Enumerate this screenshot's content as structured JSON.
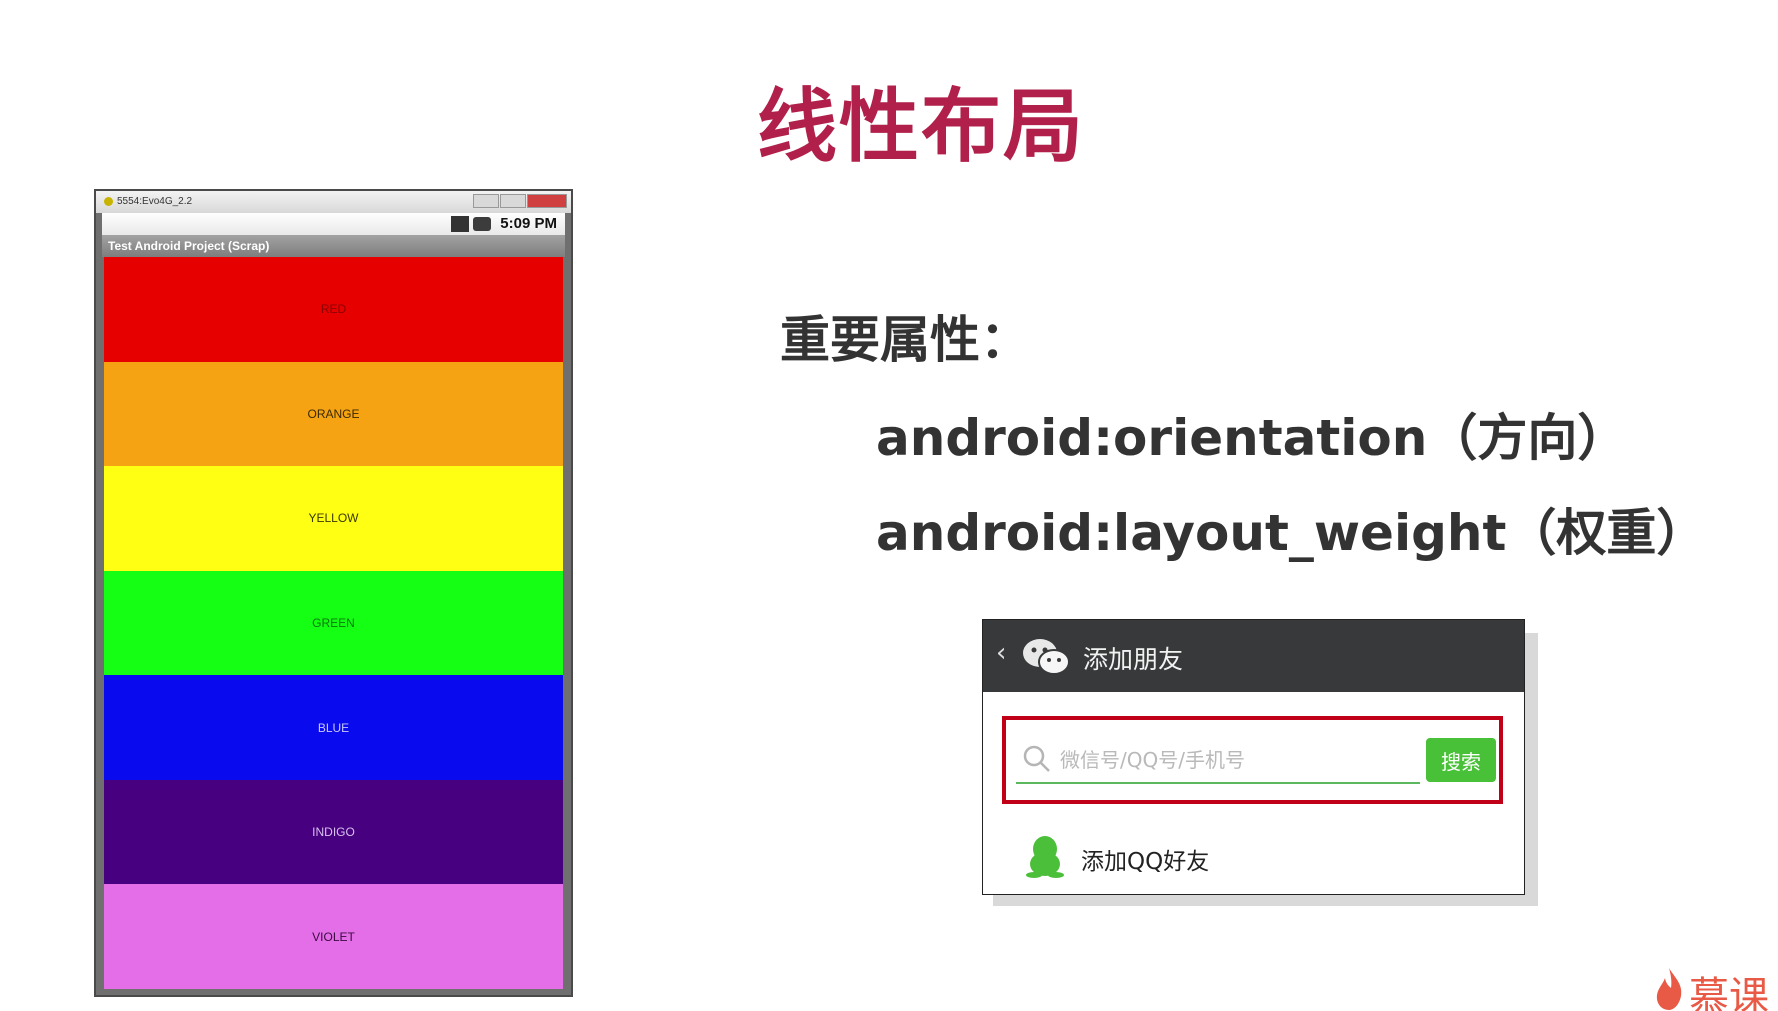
{
  "slide": {
    "title": "线性布局"
  },
  "emulator": {
    "window_title": "5554:Evo4G_2.2",
    "clock": "5:09 PM",
    "app_title": "Test Android Project (Scrap)",
    "stripes": [
      {
        "label": "RED",
        "bg": "#e60000",
        "fg": "#8a0000"
      },
      {
        "label": "ORANGE",
        "bg": "#f6a313",
        "fg": "#3a2a00"
      },
      {
        "label": "YELLOW",
        "bg": "#ffff14",
        "fg": "#3a3a00"
      },
      {
        "label": "GREEN",
        "bg": "#14ff14",
        "fg": "#0a7a0a"
      },
      {
        "label": "BLUE",
        "bg": "#0a0aee",
        "fg": "#c8c8ff"
      },
      {
        "label": "INDIGO",
        "bg": "#47007f",
        "fg": "#d8c0f0"
      },
      {
        "label": "VIOLET",
        "bg": "#e46ee8",
        "fg": "#3a0a40"
      }
    ]
  },
  "attributes": {
    "heading": "重要属性：",
    "items": [
      "android:orientation（方向）",
      "android:layout_weight（权重）"
    ]
  },
  "wechat": {
    "title": "添加朋友",
    "search_placeholder": "微信号/QQ号/手机号",
    "search_button": "搜索",
    "qq_item": "添加QQ好友",
    "colors": {
      "header": "#37393a",
      "accent": "#48c037",
      "highlight": "#c00016"
    }
  },
  "watermark": {
    "text": "慕课"
  }
}
